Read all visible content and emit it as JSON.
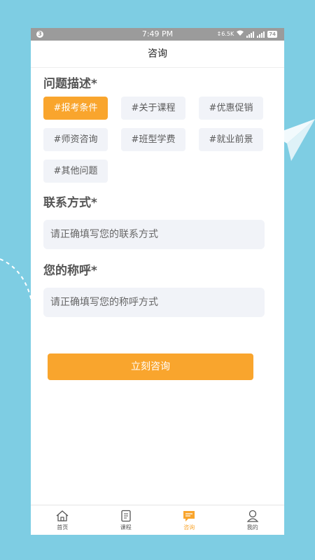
{
  "status_bar": {
    "notification_badge": "3",
    "time": "7:49 PM",
    "net_speed": "↕6.5K",
    "battery": "74"
  },
  "header": {
    "title": "咨询"
  },
  "question": {
    "title": "问题描述*",
    "tags": [
      {
        "label": "#报考条件",
        "selected": true
      },
      {
        "label": "#关于课程",
        "selected": false
      },
      {
        "label": "#优惠促销",
        "selected": false
      },
      {
        "label": "#师资咨询",
        "selected": false
      },
      {
        "label": "#班型学费",
        "selected": false
      },
      {
        "label": "#就业前景",
        "selected": false
      },
      {
        "label": "#其他问题",
        "selected": false
      }
    ]
  },
  "contact": {
    "title": "联系方式*",
    "placeholder": "请正确填写您的联系方式"
  },
  "name": {
    "title": "您的称呼*",
    "placeholder": "请正确填写您的称呼方式"
  },
  "submit_label": "立刻咨询",
  "tabbar": {
    "items": [
      {
        "label": "首页",
        "icon": "home-icon"
      },
      {
        "label": "课程",
        "icon": "course-icon"
      },
      {
        "label": "咨询",
        "icon": "chat-icon"
      },
      {
        "label": "我的",
        "icon": "user-icon"
      }
    ],
    "active_index": 2
  },
  "colors": {
    "accent": "#f9a52d",
    "background": "#7ecde3",
    "input_bg": "#f1f3f8"
  }
}
